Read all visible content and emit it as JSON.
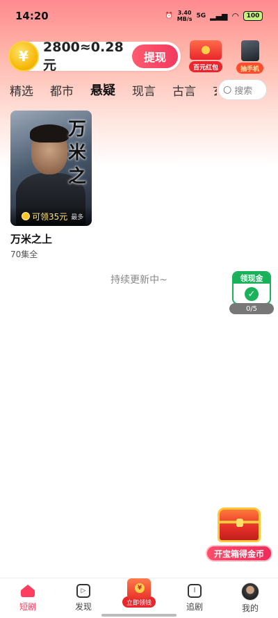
{
  "status_bar": {
    "time": "14:20",
    "net_speed_value": "3.40",
    "net_speed_unit": "MB/s",
    "network": "5G",
    "battery": "100"
  },
  "header": {
    "coin_text": "2800≈0.28元",
    "withdraw_label": "提现",
    "promo_redpack_label": "百元红包",
    "promo_phone_label": "抽手机"
  },
  "tabs": [
    {
      "label": "精选"
    },
    {
      "label": "都市"
    },
    {
      "label": "悬疑"
    },
    {
      "label": "现言"
    },
    {
      "label": "古言"
    },
    {
      "label": "玄"
    }
  ],
  "search": {
    "placeholder": "搜索"
  },
  "dramas": [
    {
      "cover_title": "万米之",
      "reward": "可领35元",
      "reward_note": "最多",
      "title": "万米之上",
      "episodes": "70集全"
    }
  ],
  "status_text": "持续更新中~",
  "cash_widget": {
    "title": "领现金",
    "progress": "0/5"
  },
  "chest_widget": {
    "label": "开宝箱得金币"
  },
  "bottom_nav": [
    {
      "label": "短剧",
      "icon": "home-icon",
      "active": true
    },
    {
      "label": "发现",
      "icon": "play-icon"
    },
    {
      "label": "立即领钱",
      "icon": "cash-envelope-icon"
    },
    {
      "label": "追剧",
      "icon": "bookmark-icon"
    },
    {
      "label": "我的",
      "icon": "avatar-icon"
    }
  ],
  "colors": {
    "accent": "#ff3d5f",
    "cash_green": "#19b25a",
    "gold": "#f5b400"
  }
}
